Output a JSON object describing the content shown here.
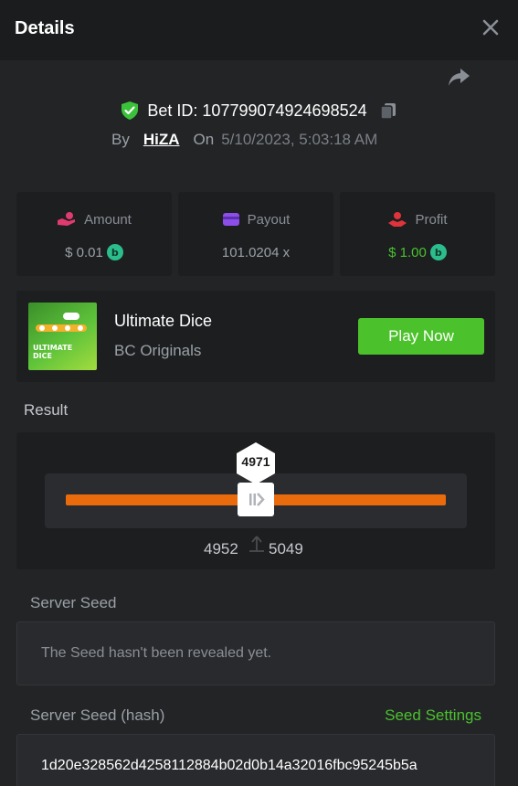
{
  "header": {
    "title": "Details",
    "close_icon": "close-icon"
  },
  "bet": {
    "label": "Bet ID:",
    "id": "107799074924698524",
    "by_label": "By",
    "user": "HiZA",
    "on_label": "On",
    "date": "5/10/2023, 5:03:18 AM"
  },
  "stats": {
    "amount": {
      "label": "Amount",
      "value": "$ 0.01",
      "icon": "amount-icon"
    },
    "payout": {
      "label": "Payout",
      "value": "101.0204 x",
      "icon": "wallet-icon"
    },
    "profit": {
      "label": "Profit",
      "value": "$ 1.00",
      "icon": "profit-icon"
    }
  },
  "coin_glyph": "b",
  "game": {
    "name": "Ultimate Dice",
    "provider": "BC Originals",
    "thumb_text": "ULTIMATE\nDICE",
    "play_label": "Play Now"
  },
  "result": {
    "label": "Result",
    "value": "4971",
    "range_low": "4952",
    "range_high": "5049"
  },
  "server_seed": {
    "label": "Server Seed",
    "message": "The Seed hasn't been revealed yet."
  },
  "server_seed_hash": {
    "label": "Server Seed (hash)",
    "settings_label": "Seed Settings",
    "value": "1d20e328562d4258112884b02d0b14a32016fbc95245b5a"
  },
  "colors": {
    "accent_green": "#4bc22b",
    "track_orange": "#ea6b0c",
    "bg": "#232426",
    "panel": "#1d1e20"
  }
}
